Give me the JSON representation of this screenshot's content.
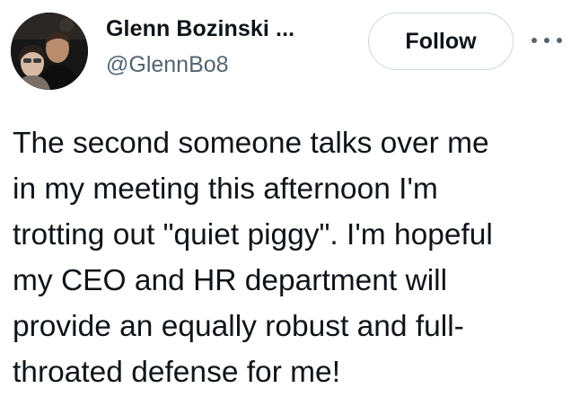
{
  "tweet": {
    "author": {
      "display_name": "Glenn Bozinski ...",
      "handle": "@GlennBo8",
      "avatar": "profile-photo"
    },
    "follow_label": "Follow",
    "more_icon": "more-horizontal-icon",
    "text_lines": [
      "The second someone talks over me",
      "in my meeting this afternoon I'm",
      "trotting out \"quiet piggy\". I'm hopeful",
      "my CEO and HR department will",
      "provide an equally robust and full-",
      "throated defense for me!"
    ]
  },
  "colors": {
    "text_primary": "#0f1419",
    "text_secondary": "#536471",
    "button_border": "#cfd9de",
    "background": "#ffffff"
  }
}
